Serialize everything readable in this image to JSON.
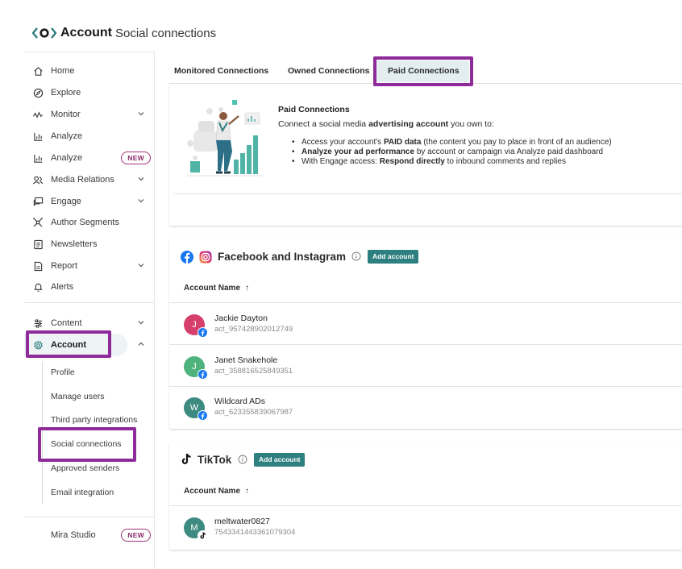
{
  "header": {
    "brand": "Account",
    "subtitle": "Social connections"
  },
  "sidebar": {
    "items": [
      {
        "label": "Home",
        "icon": "home-icon"
      },
      {
        "label": "Explore",
        "icon": "compass-icon"
      },
      {
        "label": "Monitor",
        "icon": "pulse-icon",
        "chevron": "down"
      },
      {
        "label": "Analyze",
        "icon": "bar-chart-icon"
      },
      {
        "label": "Analyze",
        "icon": "bar-chart-icon",
        "badge": "NEW"
      },
      {
        "label": "Media Relations",
        "icon": "people-icon",
        "chevron": "down"
      },
      {
        "label": "Engage",
        "icon": "chat-icon",
        "chevron": "down"
      },
      {
        "label": "Author Segments",
        "icon": "network-icon"
      },
      {
        "label": "Newsletters",
        "icon": "newsletter-icon"
      },
      {
        "label": "Report",
        "icon": "report-icon",
        "chevron": "down"
      },
      {
        "label": "Alerts",
        "icon": "bell-icon"
      },
      {
        "label": "Content",
        "icon": "sliders-icon",
        "chevron": "down"
      },
      {
        "label": "Account",
        "icon": "gear-icon",
        "chevron": "up"
      }
    ],
    "account_sub": [
      "Profile",
      "Manage users",
      "Third party integrations",
      "Social connections",
      "Approved senders",
      "Email integration"
    ],
    "footer": {
      "label": "Mira Studio",
      "badge": "NEW"
    }
  },
  "tabs": [
    "Monitored Connections",
    "Owned Connections",
    "Paid Connections"
  ],
  "active_tab": "Paid Connections",
  "info": {
    "title": "Paid Connections",
    "desc_pre": "Connect a social media ",
    "desc_bold": "advertising account",
    "desc_post": " you own to:",
    "bullets": [
      {
        "pre": "Access your account's ",
        "bold": "PAID data",
        "post": " (the content you pay to place in front of an audience)"
      },
      {
        "pre": "",
        "bold": "Analyze your ad performance",
        "post": " by account or campaign via Analyze paid dashboard"
      },
      {
        "pre": "With Engage access: ",
        "bold": "Respond directly",
        "post": " to inbound comments and replies"
      }
    ]
  },
  "facebook_section": {
    "title": "Facebook and Instagram",
    "add_label": "Add account",
    "column": "Account Name",
    "accounts": [
      {
        "initial": "J",
        "name": "Jackie Dayton",
        "id": "act_957428902012749",
        "color": "#d63f6c"
      },
      {
        "initial": "J",
        "name": "Janet Snakehole",
        "id": "act_358816525849351",
        "color": "#4fb37d"
      },
      {
        "initial": "W",
        "name": "Wildcard ADs",
        "id": "act_623355839067987",
        "color": "#3c8a80"
      }
    ]
  },
  "tiktok_section": {
    "title": "TikTok",
    "add_label": "Add account",
    "column": "Account Name",
    "accounts": [
      {
        "initial": "M",
        "name": "meltwater0827",
        "id": "7543341443361079304",
        "color": "#3c8a80"
      }
    ]
  },
  "colors": {
    "accent": "#2e7f80",
    "highlight": "#8e2a9a",
    "badge": "#a0327a",
    "facebook": "#1877f2"
  }
}
